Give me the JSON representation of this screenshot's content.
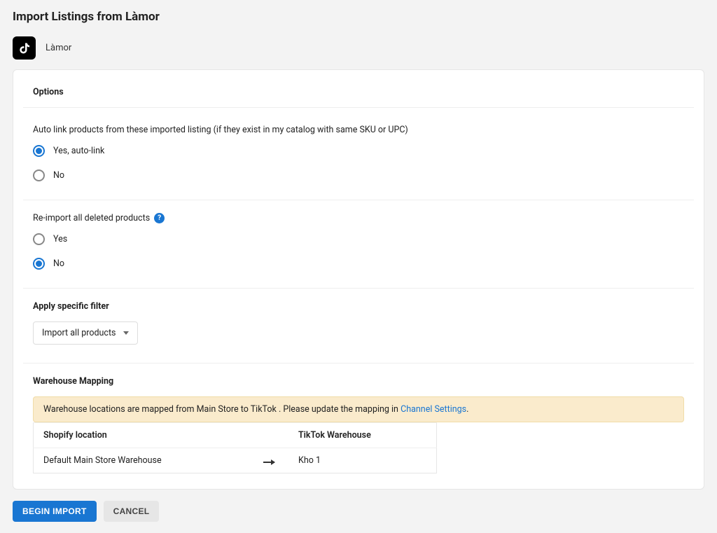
{
  "header": {
    "title": "Import Listings from Làmor",
    "shop_name": "Làmor"
  },
  "options": {
    "section_title": "Options",
    "auto_link": {
      "question": "Auto link products from these imported listing (if they exist in my catalog with same SKU or UPC)",
      "options": [
        {
          "label": "Yes, auto-link",
          "selected": true
        },
        {
          "label": "No",
          "selected": false
        }
      ]
    },
    "reimport": {
      "question": "Re-import all deleted products",
      "options": [
        {
          "label": "Yes",
          "selected": false
        },
        {
          "label": "No",
          "selected": true
        }
      ]
    }
  },
  "filter": {
    "title": "Apply specific filter",
    "selected": "Import all products"
  },
  "warehouse": {
    "title": "Warehouse Mapping",
    "alert_prefix": "Warehouse locations are mapped from Main Store to TikTok . Please update the mapping in ",
    "alert_link": "Channel Settings",
    "alert_suffix": ".",
    "columns": {
      "left": "Shopify location",
      "right": "TikTok Warehouse"
    },
    "rows": [
      {
        "left": "Default Main Store Warehouse",
        "right": "Kho 1"
      }
    ]
  },
  "footer": {
    "primary": "Begin Import",
    "secondary": "Cancel"
  }
}
